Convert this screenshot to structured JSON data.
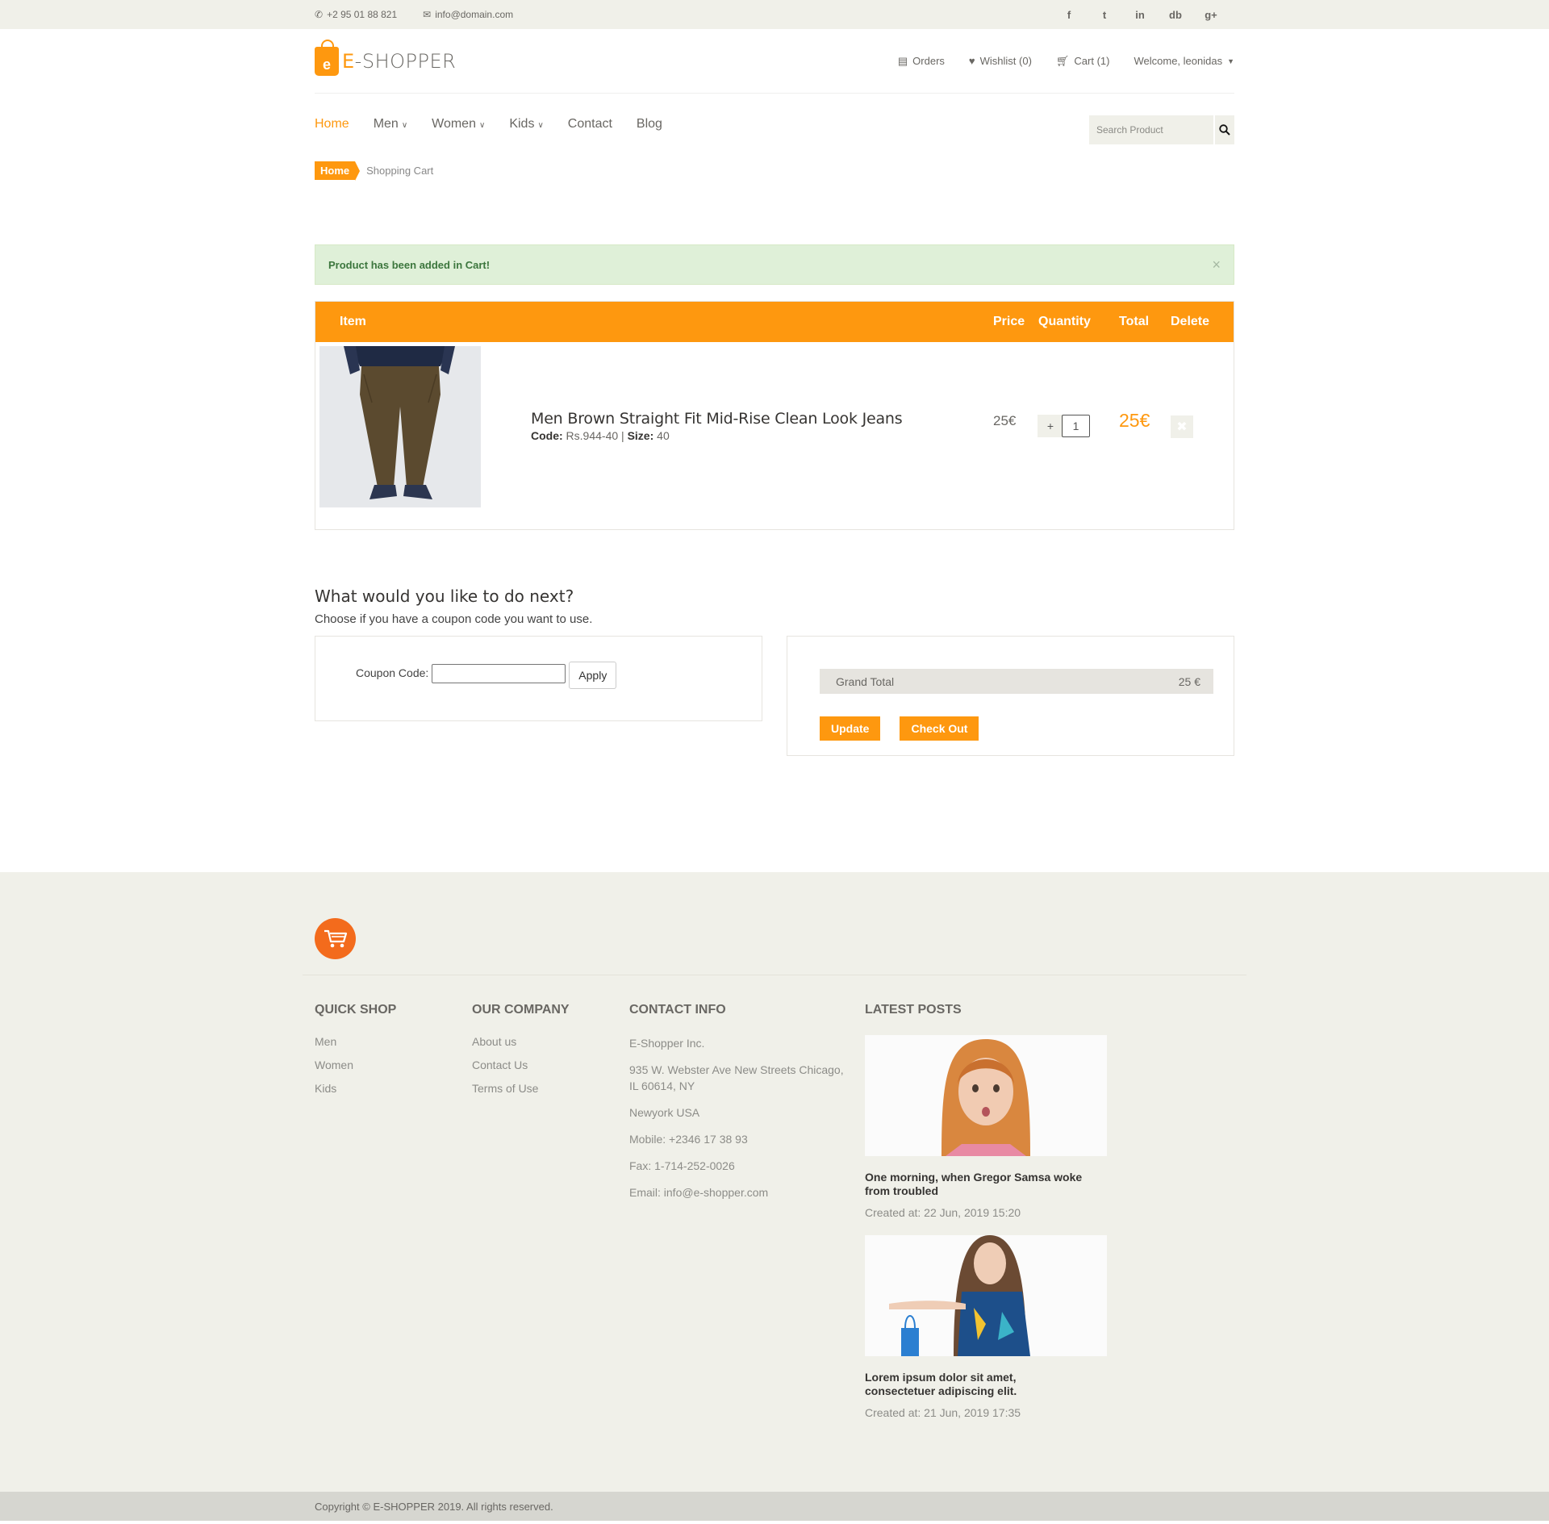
{
  "topbar": {
    "phone": "+2 95 01 88 821",
    "email": "info@domain.com",
    "social": [
      "f",
      "t",
      "in",
      "db",
      "g+"
    ]
  },
  "logo": {
    "letter": "e",
    "brand_a": "E",
    "brand_b": "-SHOPPER"
  },
  "account": {
    "orders": "Orders",
    "wishlist": "Wishlist (0)",
    "cart": "Cart (1)",
    "welcome": "Welcome, leonidas"
  },
  "nav": {
    "home": "Home",
    "men": "Men",
    "women": "Women",
    "kids": "Kids",
    "contact": "Contact",
    "blog": "Blog"
  },
  "search": {
    "placeholder": "Search Product"
  },
  "breadcrumb": {
    "home": "Home",
    "current": "Shopping Cart"
  },
  "alert": {
    "message": "Product has been added in Cart!",
    "close": "×"
  },
  "cart": {
    "headers": {
      "item": "Item",
      "price": "Price",
      "quantity": "Quantity",
      "total": "Total",
      "delete": "Delete"
    },
    "items": [
      {
        "name": "Men Brown Straight Fit Mid-Rise Clean Look Jeans",
        "code_label": "Code:",
        "code": " Rs.944-40 | ",
        "size_label": "Size:",
        "size": " 40",
        "price": "25€",
        "plus": "+",
        "quantity": "1",
        "total": "25€"
      }
    ]
  },
  "next": {
    "title": "What would you like to do next?",
    "subtitle": "Choose if you have a coupon code you want to use.",
    "coupon_label": "Coupon Code:",
    "apply": "Apply",
    "grand_total_label": "Grand Total",
    "grand_total_value": "25 €",
    "update": "Update",
    "checkout": "Check Out"
  },
  "footer": {
    "quick_shop": {
      "title": "QUICK SHOP",
      "links": [
        "Men",
        "Women",
        "Kids"
      ]
    },
    "company": {
      "title": "OUR COMPANY",
      "links": [
        "About us",
        "Contact Us",
        "Terms of Use"
      ]
    },
    "contact": {
      "title": "CONTACT INFO",
      "lines": [
        "E-Shopper Inc.",
        "935 W. Webster Ave New Streets Chicago, IL 60614, NY",
        "Newyork USA",
        "Mobile: +2346 17 38 93",
        "Fax: 1-714-252-0026",
        "Email: info@e-shopper.com"
      ]
    },
    "posts": {
      "title": "LATEST POSTS",
      "items": [
        {
          "title": "One morning, when Gregor Samsa woke from troubled",
          "date": "Created at: 22 Jun, 2019 15:20"
        },
        {
          "title": "Lorem ipsum dolor sit amet, consectetuer adipiscing elit.",
          "date": "Created at: 21 Jun, 2019 17:35"
        }
      ]
    },
    "copyright": "Copyright © E-SHOPPER 2019. All rights reserved."
  },
  "colors": {
    "accent": "#fe980f",
    "footer_bg": "#f0f0e9",
    "alert_bg": "#dff0d8",
    "alert_text": "#3c763d"
  }
}
